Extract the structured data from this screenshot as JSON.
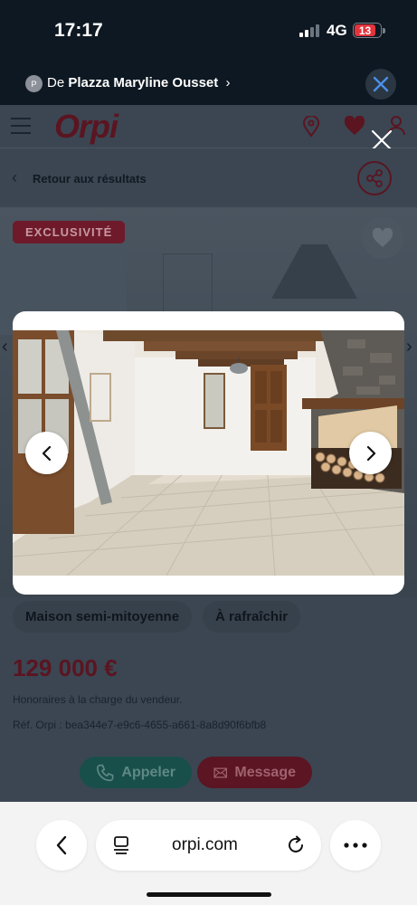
{
  "status": {
    "time": "17:17",
    "network": "4G",
    "battery": "13"
  },
  "source_bar": {
    "avatar_letter": "P",
    "prefix": "De",
    "name": "Plazza Maryline Ousset",
    "chevron": "›"
  },
  "header": {
    "logo": "Orpi"
  },
  "back_row": {
    "label": "Retour aux résultats",
    "chevron": "‹"
  },
  "listing": {
    "badge": "EXCLUSIVITÉ",
    "tags": [
      "Maison semi-mitoyenne",
      "À rafraîchir"
    ],
    "price": "129 000 €",
    "fees": "Honoraires à la charge du vendeur.",
    "reference": "Réf. Orpi : bea344e7-e9c6-4655-a661-8a8d90f6bfb8",
    "call_label": "Appeler",
    "message_label": "Message"
  },
  "browser": {
    "url": "orpi.com"
  },
  "colors": {
    "brand": "#5a1521",
    "call_green": "#184f4b",
    "status_bg": "#0e1822"
  }
}
